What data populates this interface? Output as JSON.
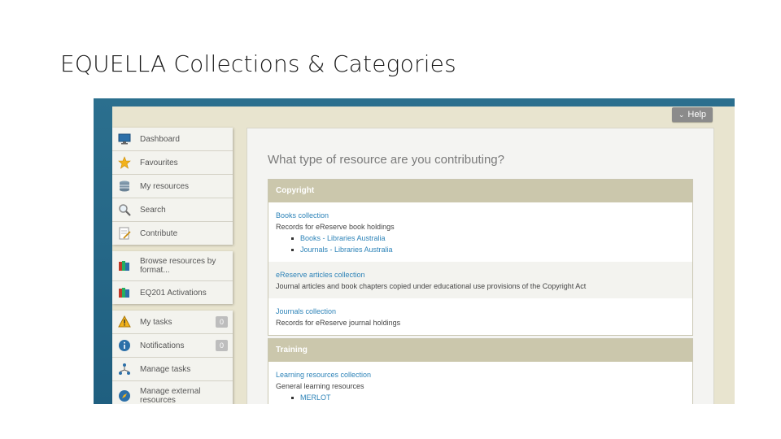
{
  "slide": {
    "title": "EQUELLA Collections & Categories"
  },
  "header": {
    "help_label": "Help"
  },
  "sidebar": {
    "groups": [
      {
        "items": [
          {
            "label": "Dashboard",
            "icon": "monitor-icon"
          },
          {
            "label": "Favourites",
            "icon": "star-icon"
          },
          {
            "label": "My resources",
            "icon": "stack-icon"
          },
          {
            "label": "Search",
            "icon": "magnifier-icon"
          },
          {
            "label": "Contribute",
            "icon": "document-icon"
          }
        ]
      },
      {
        "items": [
          {
            "label": "Browse resources by format...",
            "icon": "books-icon"
          },
          {
            "label": "EQ201 Activations",
            "icon": "books-icon"
          }
        ]
      },
      {
        "items": [
          {
            "label": "My tasks",
            "icon": "warning-icon",
            "badge": "0"
          },
          {
            "label": "Notifications",
            "icon": "info-icon",
            "badge": "0"
          },
          {
            "label": "Manage tasks",
            "icon": "workflow-icon"
          },
          {
            "label": "Manage external resources",
            "icon": "compass-icon"
          }
        ]
      }
    ]
  },
  "main": {
    "question": "What type of resource are you contributing?",
    "categories": [
      {
        "name": "Copyright",
        "collections": [
          {
            "name": "Books collection",
            "description": "Records for eReserve book holdings",
            "children": [
              "Books - Libraries Australia",
              "Journals - Libraries Australia"
            ]
          },
          {
            "name": "eReserve articles collection",
            "description": "Journal articles and book chapters copied under educational use provisions of the Copyright Act"
          },
          {
            "name": "Journals collection",
            "description": "Records for eReserve journal holdings"
          }
        ]
      },
      {
        "name": "Training",
        "collections": [
          {
            "name": "Learning resources collection",
            "description": "General learning resources",
            "children": [
              "MERLOT"
            ]
          }
        ]
      }
    ]
  },
  "colors": {
    "accent_link": "#2d83b8",
    "panel_header": "#cbc7ac",
    "frame_bg": "#e8e4cf",
    "outer_bg": "#2b6f8e"
  }
}
